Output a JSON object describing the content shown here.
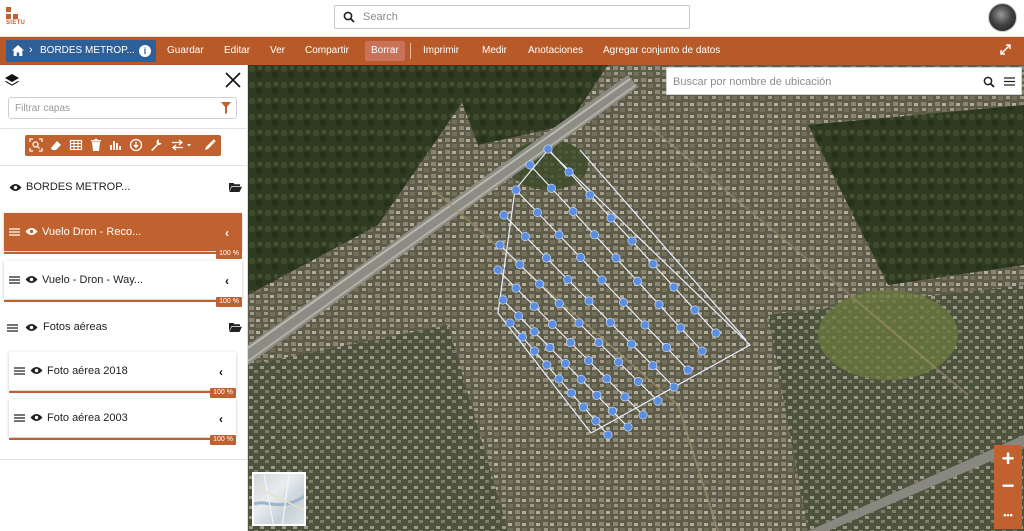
{
  "app": {
    "logo_text": "SIETU"
  },
  "search": {
    "placeholder": "Search"
  },
  "breadcrumb": {
    "title": "BORDES METROP..."
  },
  "menu": {
    "items": [
      "Guardar",
      "Editar",
      "Ver",
      "Compartir",
      "Borrar",
      "Imprimir",
      "Medir",
      "Anotaciones",
      "Agregar conjunto de datos"
    ]
  },
  "sidebar": {
    "filter_placeholder": "Filtrar capas",
    "groups": [
      {
        "label": "BORDES METROP..."
      },
      {
        "label": "Fotos aéreas"
      }
    ],
    "layers": [
      {
        "label": "Vuelo Dron - Reco...",
        "opacity": "100 %"
      },
      {
        "label": "Vuelo - Dron - Way...",
        "opacity": "100 %"
      },
      {
        "label": "Foto aérea 2018",
        "opacity": "100 %"
      },
      {
        "label": "Foto aérea 2003",
        "opacity": "100 %"
      }
    ]
  },
  "map": {
    "location_search_placeholder": "Buscar por nombre de ubicación",
    "zoom_in": "+",
    "zoom_out": "−",
    "more": "•••"
  },
  "colors": {
    "accent": "#c0622f",
    "breadcrumb": "#2f5f97",
    "waypoint": "#5b8ee0"
  },
  "icons": [
    "home-icon",
    "info-icon",
    "expand-icon",
    "layers-icon",
    "close-icon",
    "filter-icon",
    "eye-icon",
    "folder-icon",
    "drag-handle-icon",
    "chevron-left-icon",
    "search-icon",
    "menu-icon"
  ]
}
